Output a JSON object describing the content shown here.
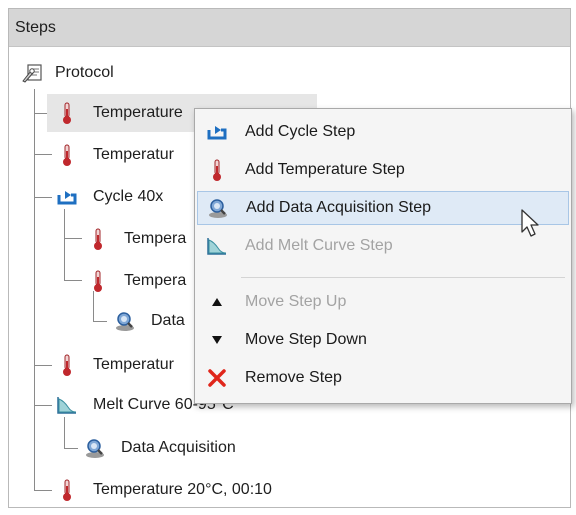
{
  "panel": {
    "title": "Steps"
  },
  "tree": {
    "protocol": "Protocol",
    "items": [
      {
        "label": "Temperature",
        "icon": "thermometer-icon"
      },
      {
        "label": "Temperatur",
        "icon": "thermometer-icon"
      },
      {
        "label": "Cycle 40x",
        "icon": "cycle-icon"
      },
      {
        "label": "Tempera",
        "icon": "thermometer-icon"
      },
      {
        "label": "Tempera",
        "icon": "thermometer-icon"
      },
      {
        "label": "Data",
        "icon": "data-acquisition-icon"
      },
      {
        "label": "Temperatur",
        "icon": "thermometer-icon"
      },
      {
        "label": "Melt Curve 60-95°C",
        "icon": "melt-curve-icon"
      },
      {
        "label": "Data Acquisition",
        "icon": "data-acquisition-icon"
      },
      {
        "label": "Temperature 20°C, 00:10",
        "icon": "thermometer-icon"
      }
    ]
  },
  "context_menu": {
    "items": [
      {
        "label": "Add Cycle Step",
        "icon": "cycle-icon",
        "enabled": true
      },
      {
        "label": "Add Temperature Step",
        "icon": "thermometer-icon",
        "enabled": true
      },
      {
        "label": "Add Data Acquisition Step",
        "icon": "data-acquisition-icon",
        "enabled": true,
        "hovered": true
      },
      {
        "label": "Add Melt Curve Step",
        "icon": "melt-curve-icon",
        "enabled": false
      },
      {
        "label": "Move Step Up",
        "icon": "triangle-up-icon",
        "enabled": false
      },
      {
        "label": "Move Step Down",
        "icon": "triangle-down-icon",
        "enabled": true
      },
      {
        "label": "Remove Step",
        "icon": "red-x-icon",
        "enabled": true
      }
    ]
  },
  "colors": {
    "accent_blue": "#1e6fc1",
    "thermo_red": "#c0282d",
    "remove_red": "#e0261b",
    "hover_bg": "#dfeaf6"
  }
}
